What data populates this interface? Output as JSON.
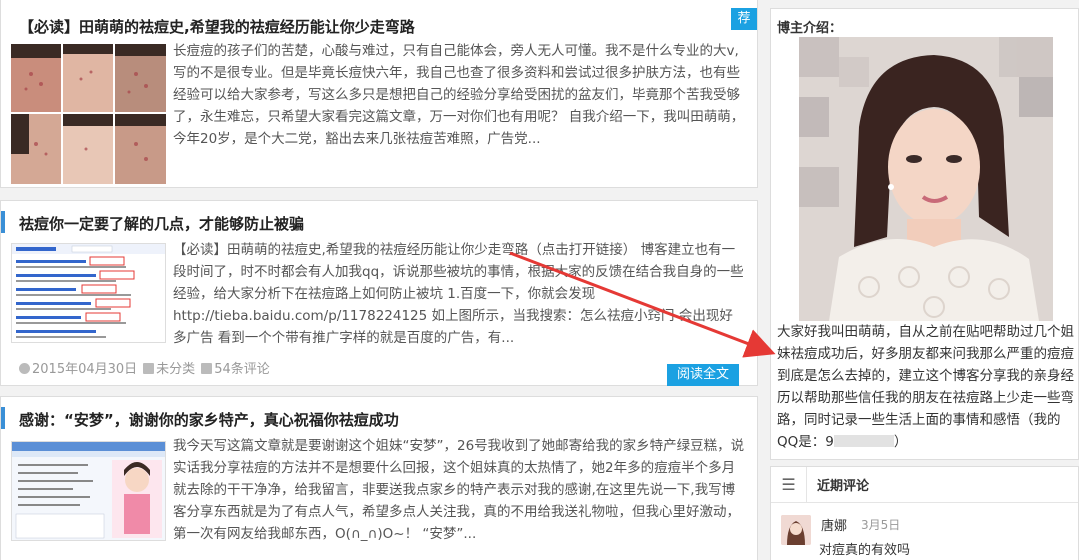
{
  "posts": [
    {
      "title": "【必读】田萌萌的祛痘史,希望我的祛痘经历能让你少走弯路",
      "badge": "荐",
      "excerpt": "长痘痘的孩子们的苦楚，心酸与难过，只有自己能体会，旁人无人可懂。我不是什么专业的大v,写的不是很专业。但是毕竟长痘快六年，我自己也查了很多资料和尝试过很多护肤方法，也有些经验可以给大家参考，写这么多只是想把自己的经验分享给受困扰的盆友们，毕竟那个苦我受够了，永生难忘，只希望大家看完这篇文章，万一对你们也有用呢？ 自我介绍一下，我叫田萌萌，今年20岁，是个大二党，豁出去来几张祛痘苦难照，广告党..."
    },
    {
      "title": "祛痘你一定要了解的几点，才能够防止被骗",
      "excerpt": "【必读】田萌萌的祛痘史,希望我的祛痘经历能让你少走弯路（点击打开链接） 博客建立也有一段时间了，时不时都会有人加我qq，诉说那些被坑的事情，根据大家的反馈在结合我自身的一些经验，给大家分析下在祛痘路上如何防止被坑  1.百度一下，你就会发现http://tieba.baidu.com/p/1178224125 如上图所示，当我搜索：怎么祛痘小窍门 会出现好多广告  看到一个个带有推广字样的就是百度的广告，有...",
      "date": "2015年04月30日",
      "category": "未分类",
      "comments": "54条评论",
      "read_more": "阅读全文"
    },
    {
      "title": "感谢：“安梦”，谢谢你的家乡特产，真心祝福你祛痘成功",
      "excerpt": "我今天写这篇文章就是要谢谢这个姐妹“安梦”，26号我收到了她邮寄给我的家乡特产绿豆糕，说实话我分享祛痘的方法并不是想要什么回报，这个姐妹真的太热情了，她2年多的痘痘半个多月就去除的干干净净，给我留言，非要送我点家乡的特产表示对我的感谢,在这里先说一下,我写博客分享东西就是为了有点人气，希望多点人关注我，真的不用给我送礼物啦，但我心里好激动，第一次有网友给我邮东西，O(∩_∩)O~！ “安梦”..."
    }
  ],
  "sidebar": {
    "about_title": "博主介绍：",
    "about_text": "大家好我叫田萌萌，自从之前在贴吧帮助过几个姐妹祛痘成功后，好多朋友都来问我那么严重的痘痘到底是怎么去掉的，建立这个博客分享我的亲身经历以帮助那些信任我的朋友在祛痘路上少走一些弯路，同时记录一些生活上面的事情和感悟（我的QQ是：9",
    "about_text_end": "）",
    "recent_title": "近期评论",
    "recent_comment": {
      "author": "唐娜",
      "date": "3月5日",
      "body": "对痘真的有效吗"
    }
  },
  "colors": {
    "accent": "#1ba1e2",
    "bar": "#3a8fd6",
    "arrow": "#e53935"
  }
}
